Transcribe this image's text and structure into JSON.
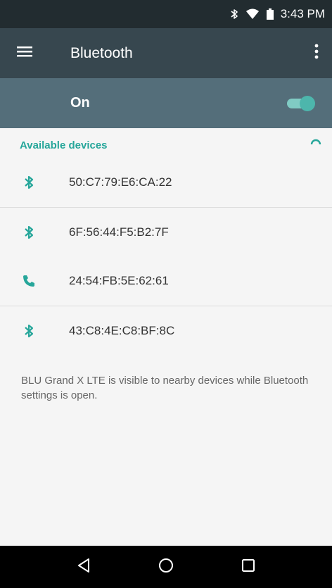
{
  "status_bar": {
    "time": "3:43 PM",
    "icons": [
      "bluetooth-icon",
      "wifi-icon",
      "battery-icon"
    ]
  },
  "app_bar": {
    "title": "Bluetooth",
    "menu_icon": "hamburger-menu-icon",
    "overflow_icon": "more-vert-icon"
  },
  "switch_bar": {
    "label": "On",
    "state": true,
    "accent": "#4db6ac"
  },
  "available_devices": {
    "header": "Available devices",
    "devices": [
      {
        "name": "50:C7:79:E6:CA:22",
        "icon": "bluetooth-icon"
      },
      {
        "name": "6F:56:44:F5:B2:7F",
        "icon": "bluetooth-icon"
      },
      {
        "name": "24:54:FB:5E:62:61",
        "icon": "phone-icon"
      },
      {
        "name": "43:C8:4E:C8:BF:8C",
        "icon": "bluetooth-icon"
      }
    ]
  },
  "visibility_note": "BLU Grand X LTE is visible to nearby devices while Bluetooth settings is open.",
  "nav_bar": {
    "icons": [
      "back-icon",
      "home-icon",
      "recents-icon"
    ]
  },
  "colors": {
    "status_bar": "#222c30",
    "app_bar": "#37474f",
    "switch_bar": "#546e7a",
    "accent": "#26a69a"
  }
}
